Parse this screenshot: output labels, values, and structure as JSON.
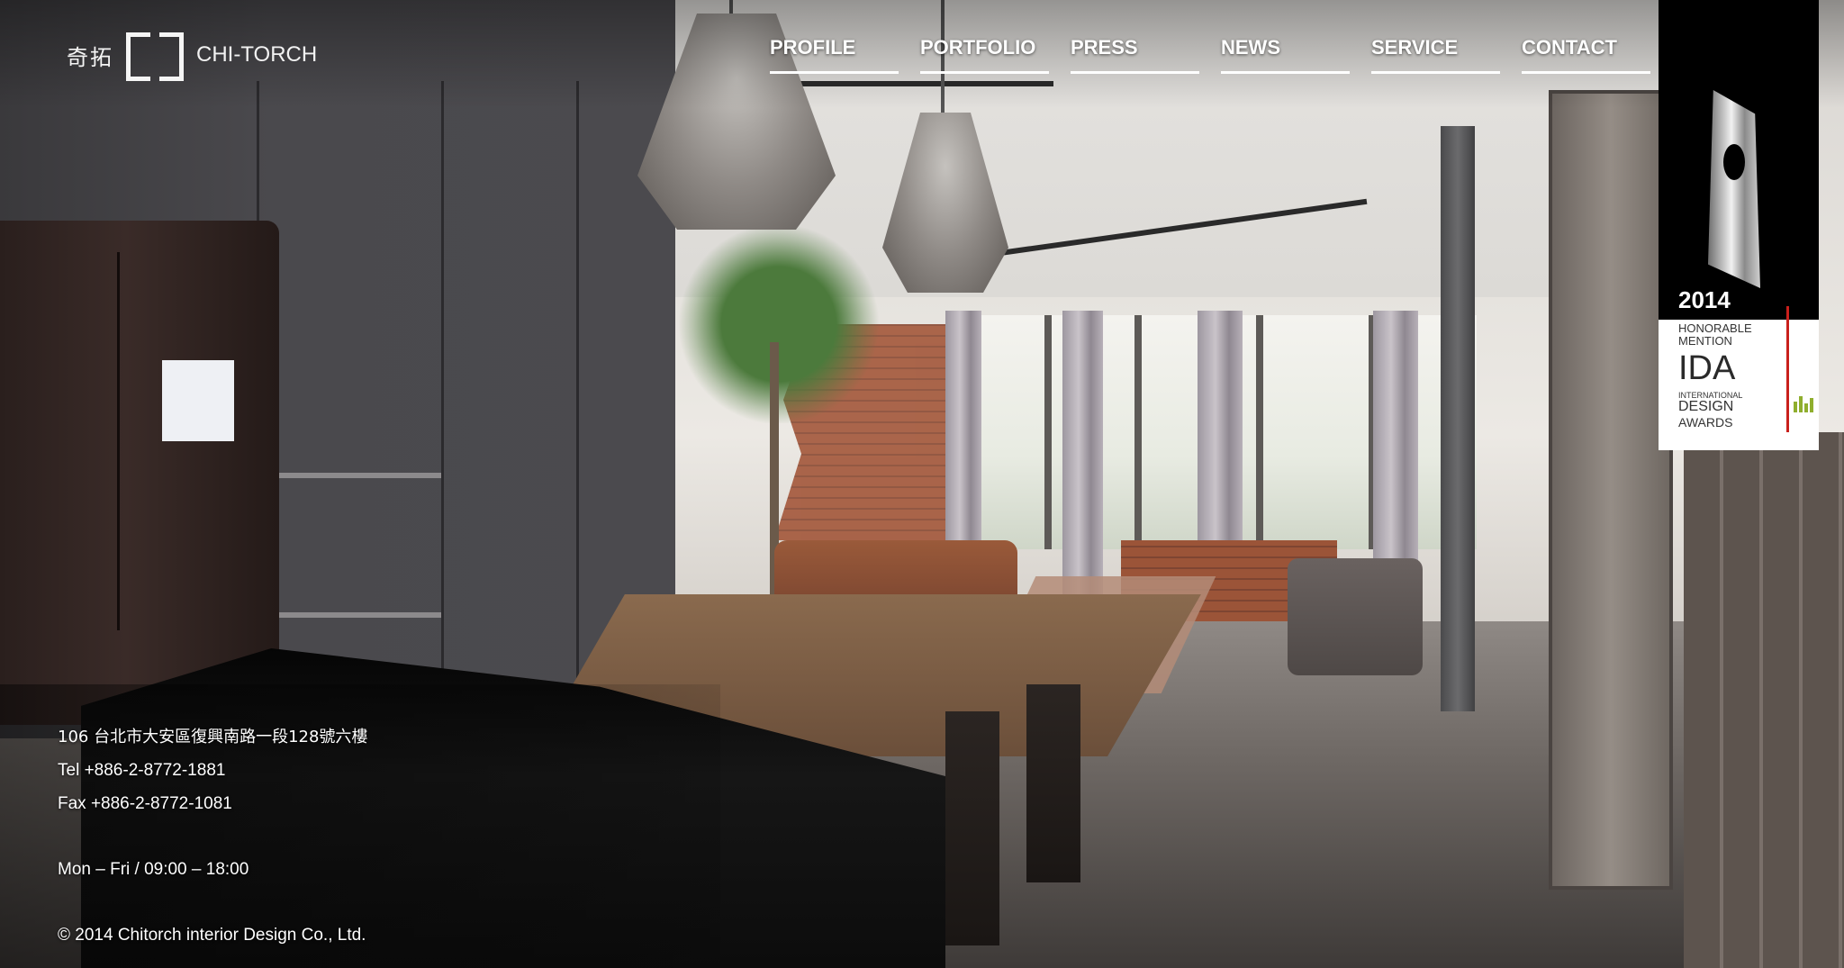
{
  "logo": {
    "chinese": "奇拓",
    "english": "CHI-TORCH"
  },
  "nav": {
    "items": [
      {
        "label": "PROFILE"
      },
      {
        "label": "PORTFOLIO"
      },
      {
        "label": "PRESS"
      },
      {
        "label": "NEWS"
      },
      {
        "label": "SERVICE"
      },
      {
        "label": "CONTACT"
      }
    ]
  },
  "award": {
    "year": "2014",
    "line1": "HONORABLE",
    "line2": "MENTION",
    "brand": "IDA",
    "line3": "INTERNATIONAL",
    "line4": "DESIGN",
    "line5": "AWARDS"
  },
  "contact": {
    "address": "106  台北市大安區復興南路一段128號六樓",
    "tel": "Tel  +886-2-8772-1881",
    "fax": "Fax +886-2-8772-1081",
    "hours": "Mon – Fri / 09:00 – 18:00",
    "copyright": "© 2014 Chitorch interior Design Co., Ltd."
  },
  "colors": {
    "nav_text": "#ffffff",
    "award_accent": "#c9201c",
    "award_bg_top": "#000000"
  }
}
